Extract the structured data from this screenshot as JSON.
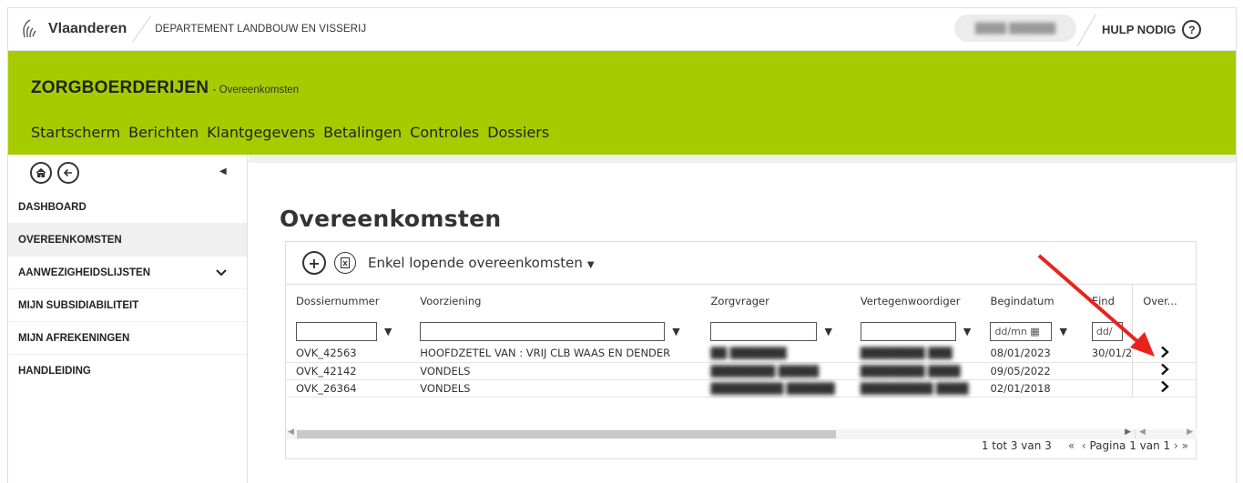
{
  "header": {
    "brand": "Vlaanderen",
    "department": "DEPARTEMENT LANDBOUW EN VISSERIJ",
    "user_name": "████ ██████",
    "help_label": "HULP NODIG",
    "help_icon": "?"
  },
  "app": {
    "title": "ZORGBOERDERIJEN",
    "subtitle": "- Overeenkomsten",
    "nav": [
      "Startscherm",
      "Berichten",
      "Klantgegevens",
      "Betalingen",
      "Controles",
      "Dossiers"
    ]
  },
  "sidebar": {
    "items": [
      {
        "label": "DASHBOARD"
      },
      {
        "label": "OVEREENKOMSTEN",
        "active": true
      },
      {
        "label": "AANWEZIGHEIDSLIJSTEN",
        "expandable": true
      },
      {
        "label": "MIJN SUBSIDIABILITEIT"
      },
      {
        "label": "MIJN AFREKENINGEN"
      },
      {
        "label": "HANDLEIDING"
      }
    ]
  },
  "main": {
    "title": "Overeenkomsten",
    "filter_label": "Enkel lopende overeenkomsten",
    "columns": [
      "Dossiernummer",
      "Voorziening",
      "Zorgvrager",
      "Vertegenwoordiger",
      "Begindatum",
      "Eind",
      "Over..."
    ],
    "date_placeholder": "dd/mn",
    "date_placeholder2": "dd/",
    "rows": [
      {
        "dossier": "OVK_42563",
        "voorziening": "HOOFDZETEL VAN : VRIJ CLB WAAS EN DENDER",
        "zorgvrager": "██ ███████",
        "vertegenwoordiger": "████████ ███",
        "begin": "08/01/2023",
        "eind": "30/01/2"
      },
      {
        "dossier": "OVK_42142",
        "voorziening": "VONDELS",
        "zorgvrager": "████████ █████",
        "vertegenwoordiger": "████████ ████",
        "begin": "09/05/2022",
        "eind": ""
      },
      {
        "dossier": "OVK_26364",
        "voorziening": "VONDELS",
        "zorgvrager": "█████████ ██████",
        "vertegenwoordiger": "█████████ ████",
        "begin": "02/01/2018",
        "eind": ""
      }
    ],
    "pager": {
      "count": "1 tot 3 van 3",
      "page": "Pagina 1 van 1"
    }
  },
  "colors": {
    "green": "#a6cc00",
    "arrow": "#e8231c"
  }
}
